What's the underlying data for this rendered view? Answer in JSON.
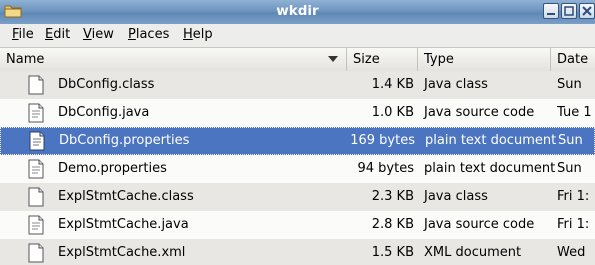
{
  "window": {
    "title": "wkdir",
    "icon": "folder-icon",
    "controls": [
      "minimize-icon",
      "maximize-icon",
      "close-icon"
    ]
  },
  "menu": {
    "items": [
      {
        "label": "File",
        "accel": "F",
        "rest": "ile"
      },
      {
        "label": "Edit",
        "accel": "E",
        "rest": "dit"
      },
      {
        "label": "View",
        "accel": "V",
        "rest": "iew"
      },
      {
        "label": "Places",
        "accel": "P",
        "rest": "laces"
      },
      {
        "label": "Help",
        "accel": "H",
        "rest": "elp"
      }
    ]
  },
  "columns": {
    "name": "Name",
    "size": "Size",
    "type": "Type",
    "date": "Date"
  },
  "files": [
    {
      "name": "DbConfig.class",
      "size": "1.4 KB",
      "type": "Java class",
      "date": "Sun",
      "selected": false
    },
    {
      "name": "DbConfig.java",
      "size": "1.0 KB",
      "type": "Java source code",
      "date": "Tue 1",
      "selected": false
    },
    {
      "name": "DbConfig.properties",
      "size": "169 bytes",
      "type": "plain text document",
      "date": "Sun",
      "selected": true
    },
    {
      "name": "Demo.properties",
      "size": "94 bytes",
      "type": "plain text document",
      "date": "Sun",
      "selected": false
    },
    {
      "name": "ExplStmtCache.class",
      "size": "2.3 KB",
      "type": "Java class",
      "date": "Fri 1:",
      "selected": false
    },
    {
      "name": "ExplStmtCache.java",
      "size": "2.8 KB",
      "type": "Java source code",
      "date": "Fri 1:",
      "selected": false
    },
    {
      "name": "ExplStmtCache.xml",
      "size": "1.5 KB",
      "type": "XML document",
      "date": "Wed",
      "selected": false
    }
  ]
}
